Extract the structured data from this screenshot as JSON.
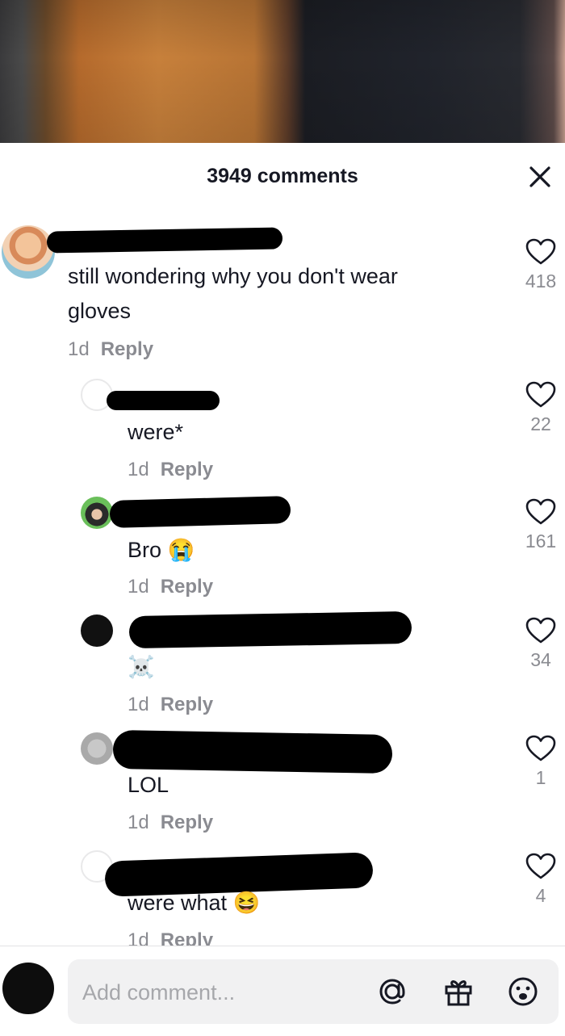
{
  "header": {
    "title": "3949 comments"
  },
  "comments": [
    {
      "text": "still wondering why you don't wear gloves",
      "time": "1d",
      "reply_label": "Reply",
      "likes": "418"
    },
    {
      "text": "were*",
      "time": "1d",
      "reply_label": "Reply",
      "likes": "22"
    },
    {
      "text": "Bro",
      "emoji": "😭",
      "time": "1d",
      "reply_label": "Reply",
      "likes": "161"
    },
    {
      "text": "☠️",
      "time": "1d",
      "reply_label": "Reply",
      "likes": "34"
    },
    {
      "text": "LOL",
      "time": "1d",
      "reply_label": "Reply",
      "likes": "1"
    },
    {
      "text": "were what",
      "emoji": "😆",
      "time": "1d",
      "reply_label": "Reply",
      "likes": "4"
    }
  ],
  "composer": {
    "placeholder": "Add comment..."
  },
  "icons": {
    "close": "close-icon",
    "like": "heart-outline-icon",
    "mention": "at-icon",
    "gift": "gift-icon",
    "emoji": "emoji-icon"
  }
}
